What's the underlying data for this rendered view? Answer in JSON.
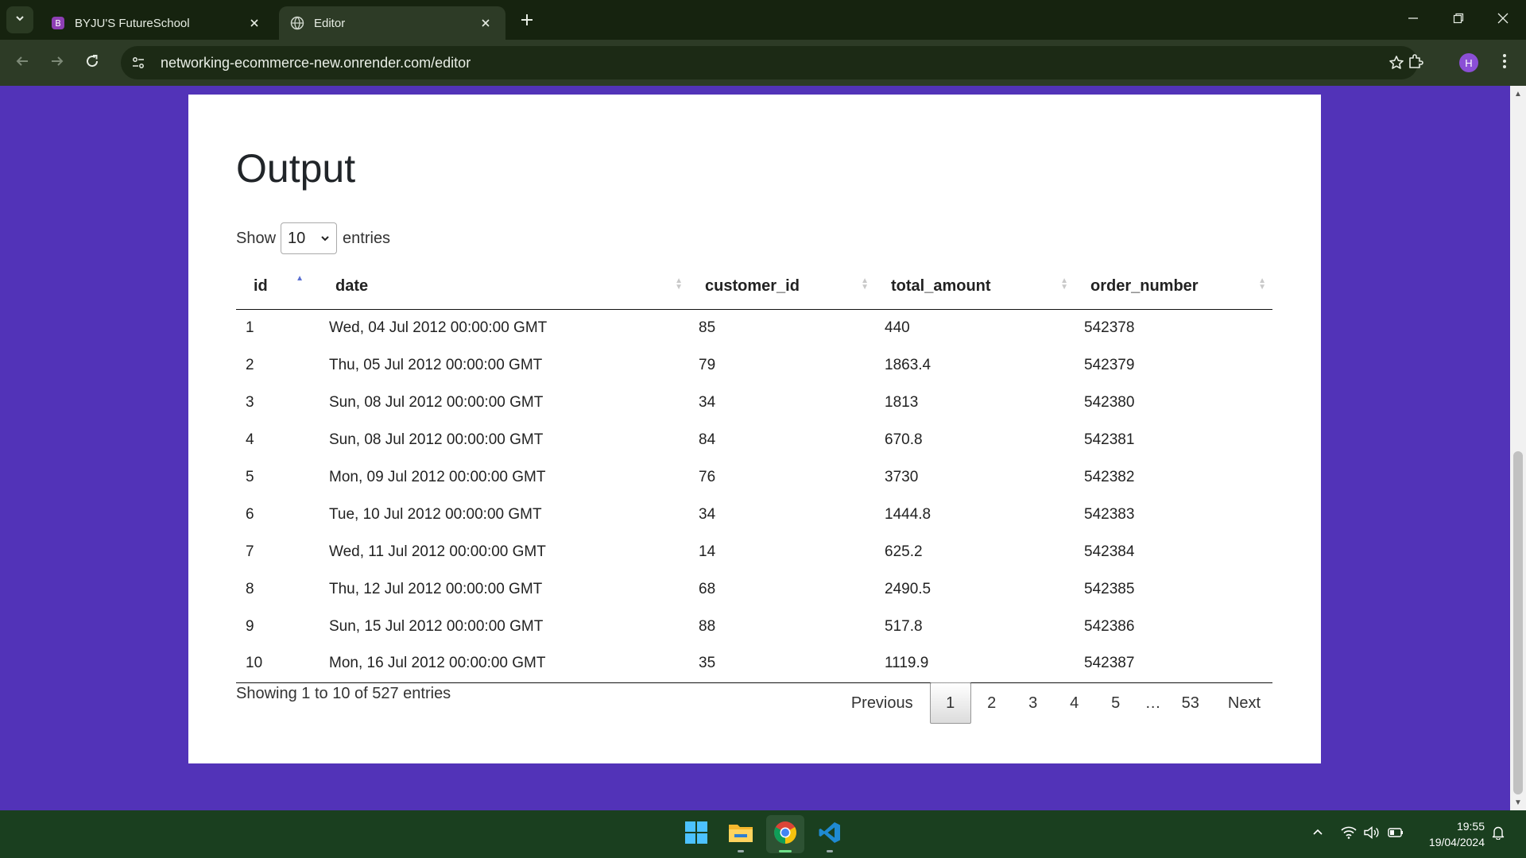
{
  "browser": {
    "tabs": [
      {
        "title": "BYJU'S FutureSchool",
        "favicon": "byjus-logo-icon",
        "active": false
      },
      {
        "title": "Editor",
        "favicon": "globe-icon",
        "active": true
      }
    ],
    "url": "networking-ecommerce-new.onrender.com/editor",
    "profile_initial": "H",
    "profile_color": "#8b4fd6"
  },
  "page": {
    "background_color": "#5233b8",
    "title": "Output",
    "length_menu": {
      "prefix": "Show",
      "selected": "10",
      "suffix": "entries"
    },
    "table": {
      "columns": [
        "id",
        "date",
        "customer_id",
        "total_amount",
        "order_number"
      ],
      "sorted_column": "id",
      "sort_direction": "asc",
      "rows": [
        [
          "1",
          "Wed, 04 Jul 2012 00:00:00 GMT",
          "85",
          "440",
          "542378"
        ],
        [
          "2",
          "Thu, 05 Jul 2012 00:00:00 GMT",
          "79",
          "1863.4",
          "542379"
        ],
        [
          "3",
          "Sun, 08 Jul 2012 00:00:00 GMT",
          "34",
          "1813",
          "542380"
        ],
        [
          "4",
          "Sun, 08 Jul 2012 00:00:00 GMT",
          "84",
          "670.8",
          "542381"
        ],
        [
          "5",
          "Mon, 09 Jul 2012 00:00:00 GMT",
          "76",
          "3730",
          "542382"
        ],
        [
          "6",
          "Tue, 10 Jul 2012 00:00:00 GMT",
          "34",
          "1444.8",
          "542383"
        ],
        [
          "7",
          "Wed, 11 Jul 2012 00:00:00 GMT",
          "14",
          "625.2",
          "542384"
        ],
        [
          "8",
          "Thu, 12 Jul 2012 00:00:00 GMT",
          "68",
          "2490.5",
          "542385"
        ],
        [
          "9",
          "Sun, 15 Jul 2012 00:00:00 GMT",
          "88",
          "517.8",
          "542386"
        ],
        [
          "10",
          "Mon, 16 Jul 2012 00:00:00 GMT",
          "35",
          "1119.9",
          "542387"
        ]
      ]
    },
    "info": "Showing 1 to 10 of 527 entries",
    "pagination": {
      "previous": "Previous",
      "pages": [
        "1",
        "2",
        "3",
        "4",
        "5",
        "…",
        "53"
      ],
      "current": "1",
      "next": "Next"
    }
  },
  "taskbar": {
    "apps": [
      "windows-start-icon",
      "file-explorer-icon",
      "chrome-icon",
      "vscode-icon"
    ],
    "active_app": "chrome-icon",
    "time": "19:55",
    "date": "19/04/2024"
  }
}
